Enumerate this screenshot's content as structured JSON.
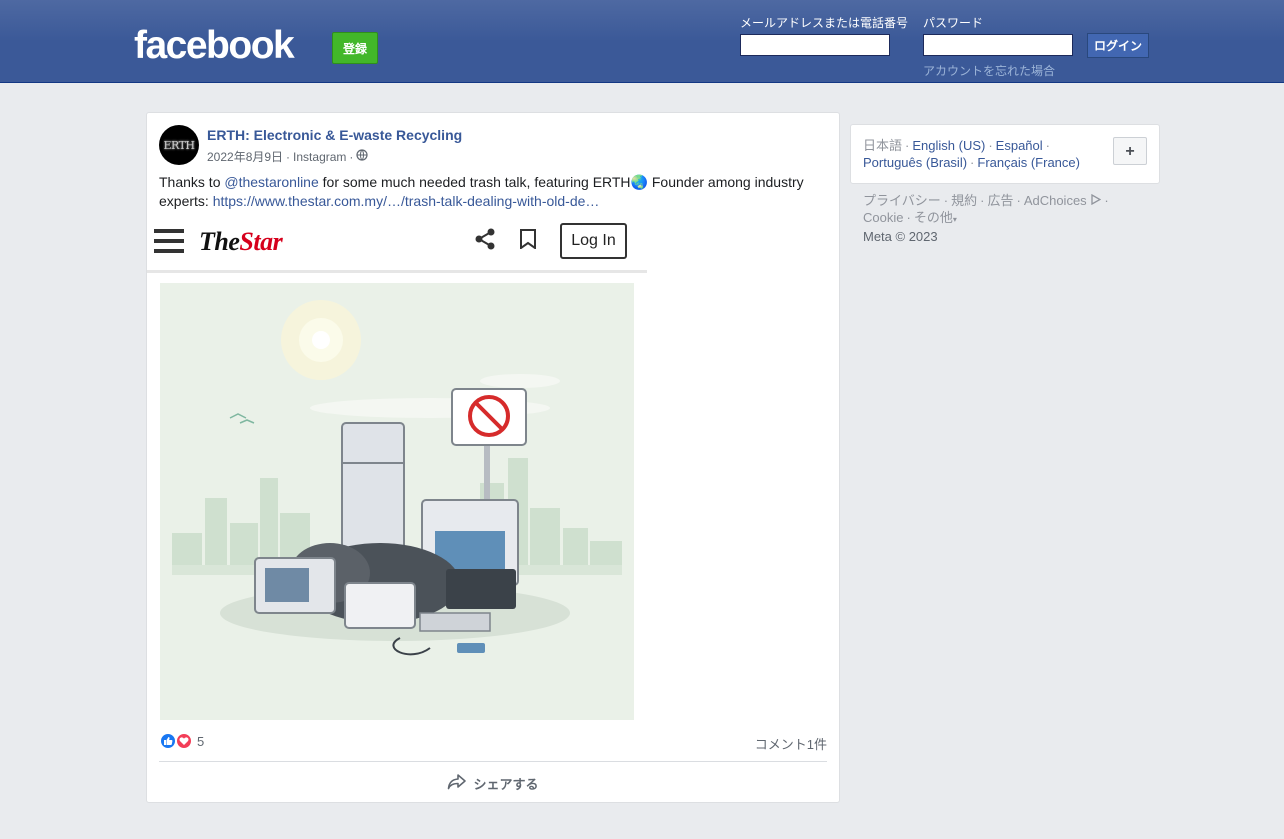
{
  "header": {
    "logo_text": "facebook",
    "signup_label": "登録",
    "email_label": "メールアドレスまたは電話番号",
    "email_value": "",
    "password_label": "パスワード",
    "password_value": "",
    "login_label": "ログイン",
    "forgot_label": "アカウントを忘れた場合"
  },
  "post": {
    "avatar_text": "ERTH",
    "page_name": "ERTH: Electronic & E-waste Recycling",
    "date": "2022年8月9日",
    "source": "Instagram",
    "text_before": "Thanks to ",
    "mention": "@thestaronline",
    "text_after": " for some much needed trash talk, featuring ERTH🌏 Founder among industry experts: ",
    "url": "https://www.thestar.com.my/…/trash-talk-dealing-with-old-de…",
    "image": {
      "site_logo_a": "The",
      "site_logo_b": "Star",
      "login_label": "Log In"
    },
    "reaction_count": "5",
    "comments_label": "コメント1件",
    "share_label": "シェアする"
  },
  "sidebar": {
    "current_language": "日本語",
    "languages": [
      "English (US)",
      "Español",
      "Português (Brasil)",
      "Français (France)"
    ],
    "plus_label": "+",
    "footer_links": [
      "プライバシー",
      "規約",
      "広告",
      "AdChoices",
      "Cookie",
      "その他"
    ],
    "copyright": "Meta © 2023"
  },
  "colors": {
    "brand_blue": "#3b5998",
    "signup_green": "#42b72a",
    "link": "#385898"
  }
}
